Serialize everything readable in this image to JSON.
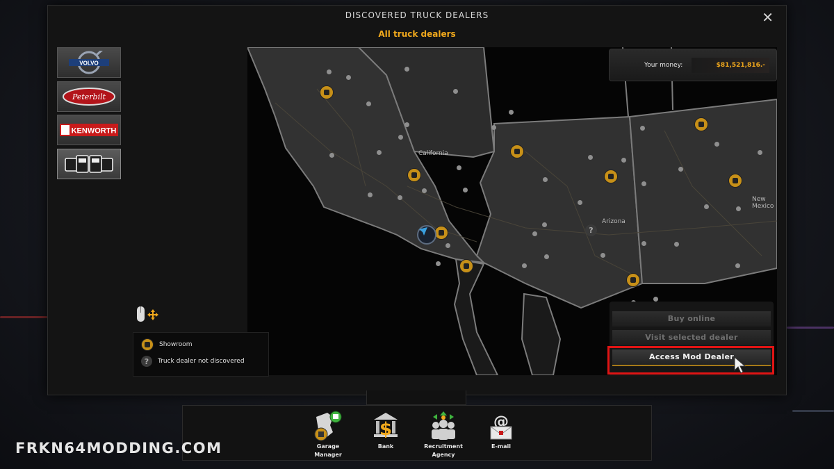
{
  "window": {
    "title": "DISCOVERED TRUCK DEALERS",
    "subtitle": "All truck dealers",
    "close_symbol": "✕"
  },
  "brands": [
    {
      "name": "Volvo",
      "text": "VOLVO",
      "selected": false
    },
    {
      "name": "Peterbilt",
      "text": "Peterbilt",
      "selected": false
    },
    {
      "name": "Kenworth",
      "text": "KENWORTH",
      "selected": false
    },
    {
      "name": "All trucks",
      "text": "",
      "selected": true
    }
  ],
  "money": {
    "label": "Your money:",
    "value": "$81,521,816.-"
  },
  "map": {
    "regions": [
      "California",
      "Arizona",
      "New Mexico"
    ],
    "unknown_symbol": "?"
  },
  "actions": {
    "buy_online": "Buy online",
    "visit_dealer": "Visit selected dealer",
    "access_mod_dealer": "Access Mod Dealer"
  },
  "legend": {
    "showroom": "Showroom",
    "not_discovered": "Truck dealer not discovered",
    "unknown_symbol": "?"
  },
  "bottom_nav": [
    {
      "label_1": "Garage",
      "label_2": "Manager"
    },
    {
      "label_1": "Bank",
      "label_2": ""
    },
    {
      "label_1": "Recruitment",
      "label_2": "Agency"
    },
    {
      "label_1": "E-mail",
      "label_2": ""
    }
  ],
  "watermark": "FRKN64MODDING.COM",
  "colors": {
    "accent": "#f0a81c",
    "highlight_border": "#e01414",
    "dealer_marker": "#c79018"
  }
}
